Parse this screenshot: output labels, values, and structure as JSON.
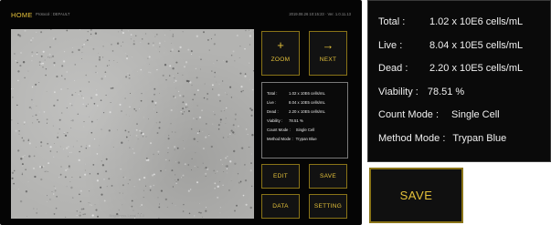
{
  "header": {
    "home_label": "HOME",
    "protocol_text": "Protocol : DEFAULT",
    "datetime_text": "2019.08.26 10:15:23  ·  Ver. 1.0.11.13"
  },
  "image_footer": {
    "brightness_text": "Brightness Level : 1.0"
  },
  "buttons": {
    "zoom": {
      "glyph": "+",
      "label": "ZOOM"
    },
    "next": {
      "glyph": "→",
      "label": "NEXT"
    },
    "edit": "EDIT",
    "save": "SAVE",
    "data": "DATA",
    "setting": "SETTING"
  },
  "results": [
    {
      "label": "Total :",
      "value": "1.02 x 10E6 cells/mL"
    },
    {
      "label": "Live :",
      "value": "8.04 x 10E5 cells/mL"
    },
    {
      "label": "Dead :",
      "value": "2.20 x 10E5 cells/mL"
    },
    {
      "label": "Viability :",
      "value": "78.51 %"
    },
    {
      "label": "Count Mode :",
      "value": "Single Cell"
    },
    {
      "label": "Method Mode :",
      "value": "Trypan Blue"
    }
  ],
  "zoom_save_label": "SAVE",
  "colors": {
    "accent": "#e4c13a",
    "button_border": "#8a7418",
    "screen_bg": "#050505",
    "image_bg": "#b3b3b1"
  }
}
